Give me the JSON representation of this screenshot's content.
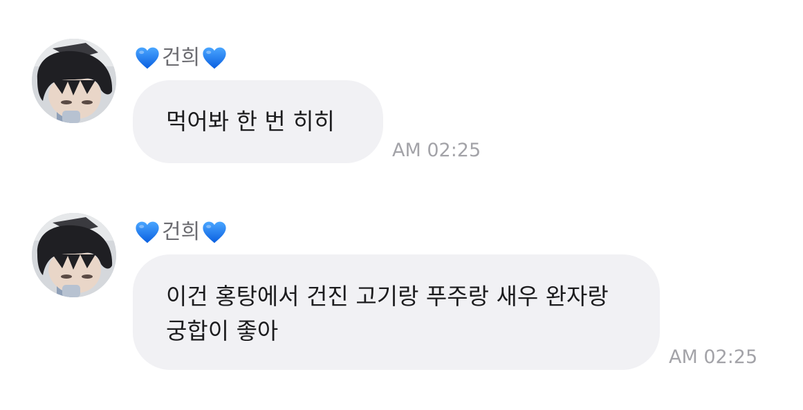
{
  "messages": [
    {
      "sender_name": "건희",
      "sender_emoji": "blue-heart-icon",
      "text": "먹어봐 한 번 히히",
      "time": "AM 02:25"
    },
    {
      "sender_name": "건희",
      "sender_emoji": "blue-heart-icon",
      "text": "이건 홍탕에서 건진 고기랑 푸주랑 새우 완자랑 궁합이 좋아",
      "time": "AM 02:25"
    }
  ],
  "colors": {
    "bubble": "#f1f1f4",
    "text": "#1c1c1e",
    "sender": "#6b6b70",
    "time": "#a3a3a8",
    "heart": "#1a7cf5"
  }
}
